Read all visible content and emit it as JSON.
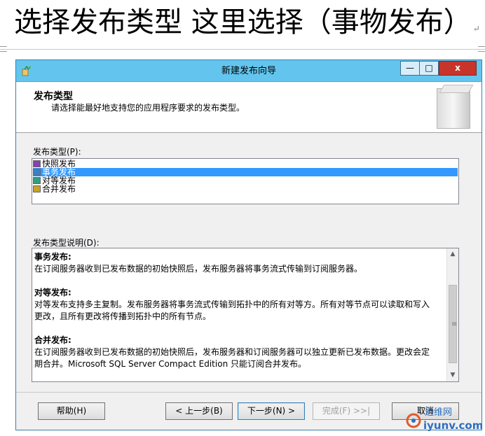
{
  "caption": {
    "text": "选择发布类型 这里选择（事物发布）",
    "return_mark": "↵"
  },
  "window": {
    "title": "新建发布向导",
    "controls": {
      "minimize": "—",
      "maximize": "□",
      "close": "x"
    }
  },
  "header": {
    "title": "发布类型",
    "description": "请选择能最好地支持您的应用程序要求的发布类型。"
  },
  "publication_types": {
    "label": "发布类型(P):",
    "items": [
      {
        "label": "快照发布",
        "selected": false,
        "icon": "snapshot-icon",
        "color": "#8a3fb5"
      },
      {
        "label": "事务发布",
        "selected": true,
        "icon": "transaction-icon",
        "color": "#3f7fbf"
      },
      {
        "label": "对等发布",
        "selected": false,
        "icon": "peer-icon",
        "color": "#2f9f7f"
      },
      {
        "label": "合并发布",
        "selected": false,
        "icon": "merge-icon",
        "color": "#c9a227"
      }
    ]
  },
  "description": {
    "label": "发布类型说明(D):",
    "sections": [
      {
        "title": "事务发布:",
        "body": "在订阅服务器收到已发布数据的初始快照后，发布服务器将事务流式传输到订阅服务器。"
      },
      {
        "title": "对等发布:",
        "body": "对等发布支持多主复制。发布服务器将事务流式传输到拓扑中的所有对等方。所有对等节点可以读取和写入\n更改，且所有更改将传播到拓扑中的所有节点。"
      },
      {
        "title": "合并发布:",
        "body": "在订阅服务器收到已发布数据的初始快照后，发布服务器和订阅服务器可以独立更新已发布数据。更改会定\n期合并。Microsoft SQL Server Compact Edition 只能订阅合并发布。"
      }
    ]
  },
  "buttons": {
    "help": "帮助(H)",
    "back": "< 上一步(B)",
    "next": "下一步(N) >",
    "finish": "完成(F) >>|",
    "cancel": "取消"
  },
  "watermark": {
    "text": "运维网",
    "url": "iyunv.com"
  }
}
